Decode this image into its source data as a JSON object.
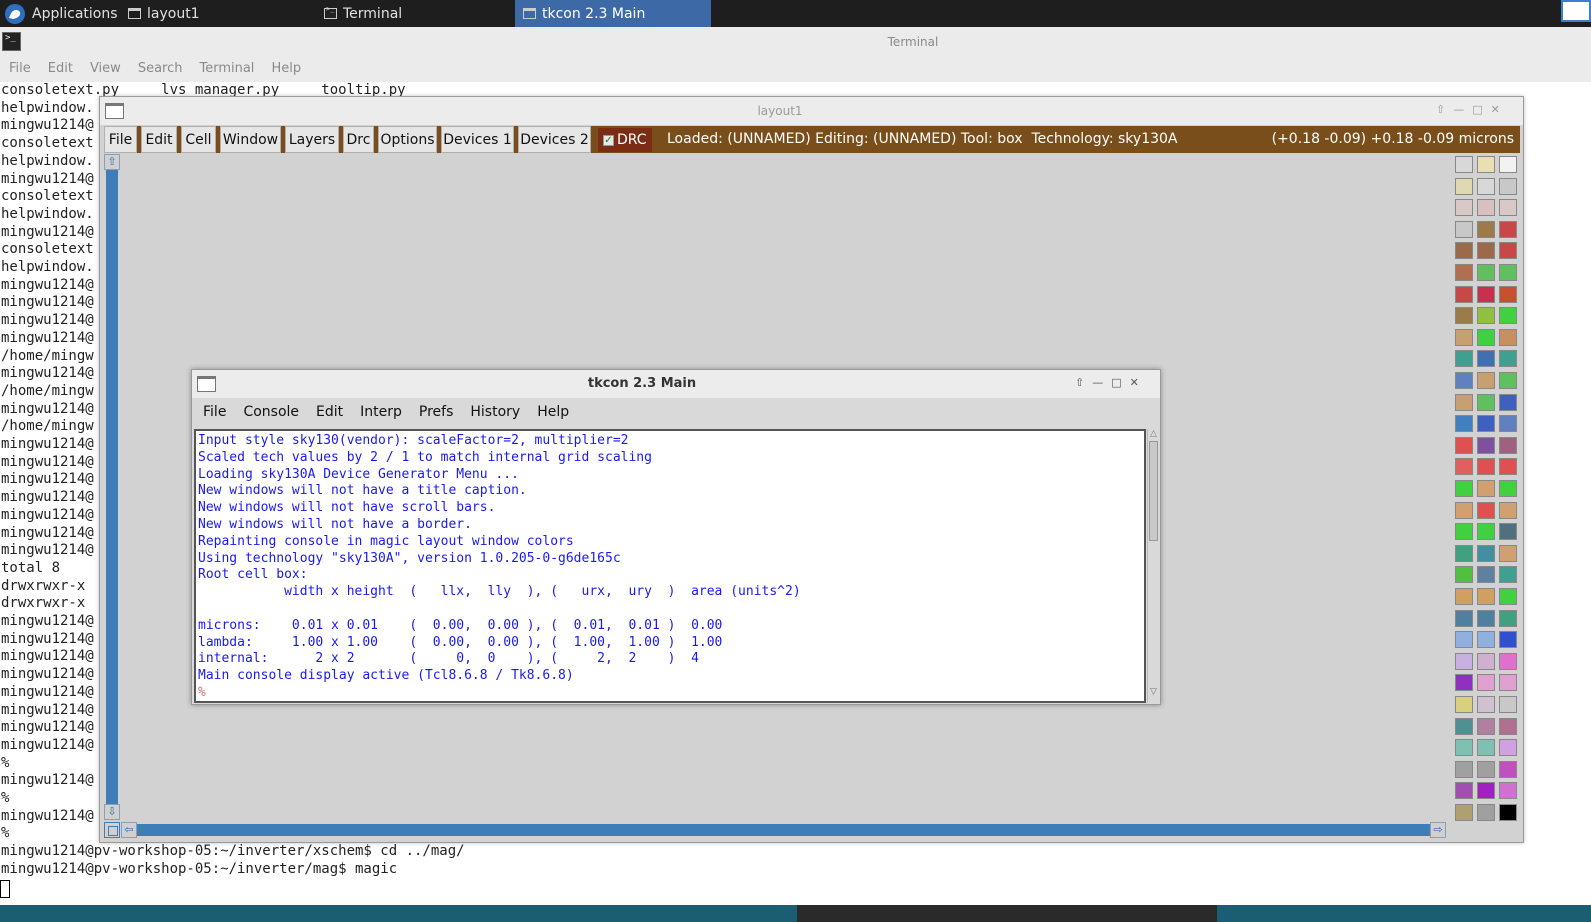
{
  "taskbar": {
    "applications_label": "Applications",
    "tasks": [
      {
        "label": "layout1"
      },
      {
        "label": "Terminal"
      },
      {
        "label": "tkcon 2.3 Main"
      }
    ]
  },
  "terminal": {
    "title": "Terminal",
    "menu": [
      "File",
      "Edit",
      "View",
      "Search",
      "Terminal",
      "Help"
    ],
    "lines": [
      "consoletext.py     lvs_manager.py     tooltip.py",
      "helpwindow.",
      "mingwu1214@",
      "consoletext",
      "helpwindow.",
      "mingwu1214@",
      "consoletext",
      "helpwindow.",
      "mingwu1214@",
      "consoletext",
      "helpwindow.",
      "mingwu1214@",
      "mingwu1214@",
      "mingwu1214@",
      "mingwu1214@",
      "/home/mingw",
      "mingwu1214@",
      "/home/mingw",
      "mingwu1214@",
      "/home/mingw",
      "mingwu1214@",
      "mingwu1214@",
      "mingwu1214@",
      "mingwu1214@",
      "mingwu1214@",
      "mingwu1214@",
      "mingwu1214@",
      "total 8",
      "drwxrwxr-x",
      "drwxrwxr-x",
      "mingwu1214@",
      "mingwu1214@",
      "mingwu1214@",
      "mingwu1214@",
      "mingwu1214@",
      "mingwu1214@",
      "mingwu1214@",
      "mingwu1214@",
      "%",
      "mingwu1214@",
      "%",
      "mingwu1214@",
      "%",
      "mingwu1214@pv-workshop-05:~/inverter/xschem$ cd ../mag/",
      "mingwu1214@pv-workshop-05:~/inverter/mag$ magic"
    ]
  },
  "layout_window": {
    "title": "layout1",
    "menu": [
      "File",
      "Edit",
      "Cell",
      "Window",
      "Layers",
      "Drc",
      "Options",
      "Devices 1",
      "Devices 2"
    ],
    "drc_label": "DRC",
    "drc_checked": true,
    "status": "Loaded: (UNNAMED) Editing: (UNNAMED) Tool: box  Technology: sky130A",
    "coords": "(+0.18 -0.09) +0.18 -0.09 microns",
    "colors": {
      "menubar": "#7a4e1a",
      "scrollbar": "#3f7db8"
    }
  },
  "tkcon": {
    "title": "tkcon 2.3 Main",
    "menu": [
      "File",
      "Console",
      "Edit",
      "Interp",
      "Prefs",
      "History",
      "Help"
    ],
    "lines": [
      "Input style sky130(vendor): scaleFactor=2, multiplier=2",
      "Scaled tech values by 2 / 1 to match internal grid scaling",
      "Loading sky130A Device Generator Menu ...",
      "New windows will not have a title caption.",
      "New windows will not have scroll bars.",
      "New windows will not have a border.",
      "Repainting console in magic layout window colors",
      "Using technology \"sky130A\", version 1.0.205-0-g6de165c",
      "Root cell box:",
      "           width x height  (   llx,  lly  ), (   urx,  ury  )  area (units^2)",
      "",
      "microns:    0.01 x 0.01    (  0.00,  0.00 ), (  0.01,  0.01 )  0.00",
      "lambda:     1.00 x 1.00    (  0.00,  0.00 ), (  1.00,  1.00 )  1.00",
      "internal:      2 x 2       (     0,  0    ), (     2,  2    )  4",
      "Main console display active (Tcl8.6.8 / Tk8.6.8)",
      "%"
    ],
    "text_color": "#1a1af0"
  }
}
